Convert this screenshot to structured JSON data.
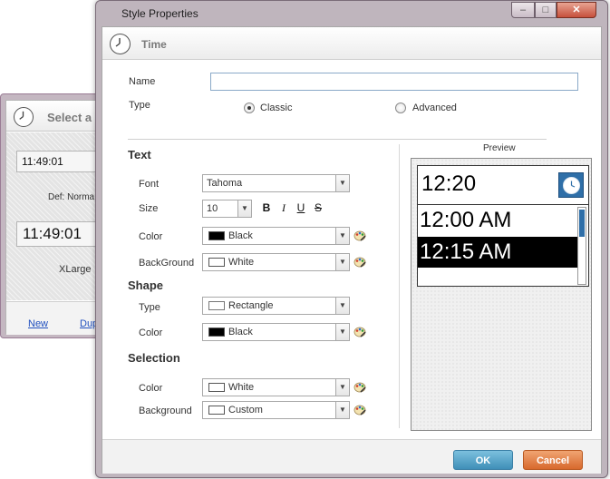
{
  "background_window": {
    "header_title": "Select a",
    "time_small": "11:49:01",
    "def_label": "Def: Norma",
    "time_large": "11:49:01",
    "size_label": "XLarge",
    "link_new": "New",
    "link_dup": "Dup"
  },
  "window": {
    "title": "Style Properties",
    "header": "Time",
    "caption_buttons": {
      "minimize": "–",
      "maximize": "□",
      "close": "✕"
    }
  },
  "form": {
    "name_label": "Name",
    "name_value": "",
    "type_label": "Type",
    "type_options": [
      "Classic",
      "Advanced"
    ],
    "type_selected": "Classic"
  },
  "text_section": {
    "title": "Text",
    "font_label": "Font",
    "font_value": "Tahoma",
    "size_label": "Size",
    "size_value": "10",
    "format_buttons": [
      "B",
      "I",
      "U",
      "S"
    ],
    "color_label": "Color",
    "color_value": "Black",
    "color_hex": "#000000",
    "background_label": "BackGround",
    "background_value": "White",
    "background_hex": "#ffffff"
  },
  "shape_section": {
    "title": "Shape",
    "type_label": "Type",
    "type_value": "Rectangle",
    "color_label": "Color",
    "color_value": "Black",
    "color_hex": "#000000"
  },
  "selection_section": {
    "title": "Selection",
    "color_label": "Color",
    "color_value": "White",
    "color_hex": "#ffffff",
    "background_label": "Background",
    "background_value": "Custom",
    "background_hex": "#ffffff"
  },
  "preview": {
    "label": "Preview",
    "time": "12:20",
    "list_items": [
      "12:00 AM",
      "12:15 AM"
    ],
    "selected_index": 1,
    "accent_hex": "#2f6fa8"
  },
  "buttons": {
    "ok": "OK",
    "cancel": "Cancel"
  },
  "icons": [
    "clock-icon",
    "palette-icon",
    "dropdown-arrow-icon"
  ]
}
